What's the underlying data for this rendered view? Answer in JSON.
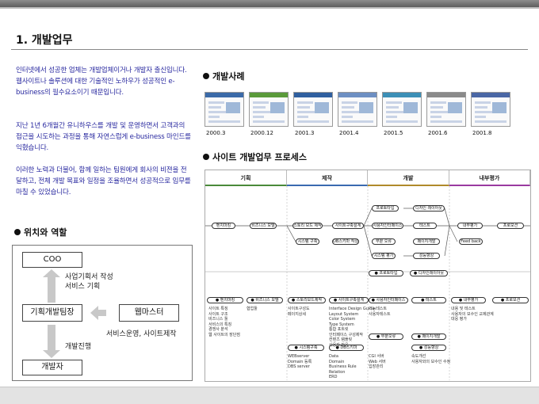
{
  "page": {
    "title": "1. 개발업무"
  },
  "intro": {
    "p1": "인터넷에서 성공한 업체는 개발업체이거나 개발자 출신입니다. 웹사이트나 솔루션에 대한 기술적인 노하우가 성공적인 e-business의 필수요소이기 때문입니다.",
    "p2": "지난 1년 6개월간 유니하우스를 개발 및 운영하면서 고객과의 접근을 시도하는 과정을 통해 자연스럽게 e-business 마인드를 익혔습니다.",
    "p3": "이러한 노력과 더불어, 함께 일하는 팀원에게 회사의 비젼을 전달하고, 전체 개발 목표와 일정을 조율하면서 성공적으로 임무를 마칠 수 있었습니다."
  },
  "roles": {
    "heading": "위치와 역할",
    "coo": "COO",
    "team": "기획개발팀장",
    "webmaster": "웹마스터",
    "developer": "개발자",
    "up_note": "사업기획서 작성\n서비스 기획",
    "side_note": "서비스운영, 사이트제작",
    "down_note": "개발진행"
  },
  "cases": {
    "heading": "개발사례",
    "items": [
      {
        "label": "2000.3",
        "color": "#3b6aa8"
      },
      {
        "label": "2000.12",
        "color": "#5a9a3a"
      },
      {
        "label": "2001.3",
        "color": "#2f5f9f"
      },
      {
        "label": "2001.4",
        "color": "#6d8fc2"
      },
      {
        "label": "2001.5",
        "color": "#3c8fb6"
      },
      {
        "label": "2001.6",
        "color": "#8a8a8a"
      },
      {
        "label": "2001.8",
        "color": "#4a67a5"
      }
    ]
  },
  "process": {
    "heading": "사이트 개발업무 프로세스",
    "phases": [
      {
        "label": "기획",
        "color": "#4a8a3a"
      },
      {
        "label": "제작",
        "color": "#3a6ab0"
      },
      {
        "label": "개발",
        "color": "#b08a2a"
      },
      {
        "label": "내부평가",
        "color": "#9a3aa0"
      }
    ],
    "flow": [
      "벤치마킹",
      "비즈니스 모델",
      "스토리 보드 제작",
      "사이트구축설계",
      "시스템 구축",
      "DB스키마 작성",
      "프로토타입",
      "사용자인터페이스",
      "디자인 레이아웃",
      "부분 오류",
      "테스트",
      "페이지개발",
      "시스템 평가",
      "성능향상",
      "내부평가",
      "Feed back",
      "프로모션"
    ],
    "legend": [
      "벤치마킹",
      "비즈니스 모델",
      "스토리보드제작",
      "사이트구축설계",
      "사용자인터페이스",
      "테스트",
      "내부평가",
      "프로모션",
      "시스템구축",
      "DB스키마",
      "부분오류",
      "페이지개발",
      "성능향상",
      "프로토타입",
      "디자인레이아웃"
    ],
    "details": [
      "사이트 특징\n사이트 구조\n비즈니스 툴\n서비스의 특징\n경쟁사 분석\n웹 사이트의 장단점",
      "협업툴",
      "사이트구성도\n페이지상세",
      "Interface Design Guide\nLayout System\nColor System\nType System\n통합 포트릿\n인터페이스 구성제작\n컨텐츠 템플릿\n사용자 반응",
      "기능테스트\n사용자테스트",
      "내용 및 테스트\n사용자의 보수인 교제관계\n대응 평가",
      "WEBserver\nDomain 등록\nDBS server",
      "Data\nDomain\nBusiness Rule\nRelation\nERD",
      "CGI 서버\nWeb 서버\n입장관리",
      "속도개선\n사용자와의 보수인 수정"
    ]
  }
}
